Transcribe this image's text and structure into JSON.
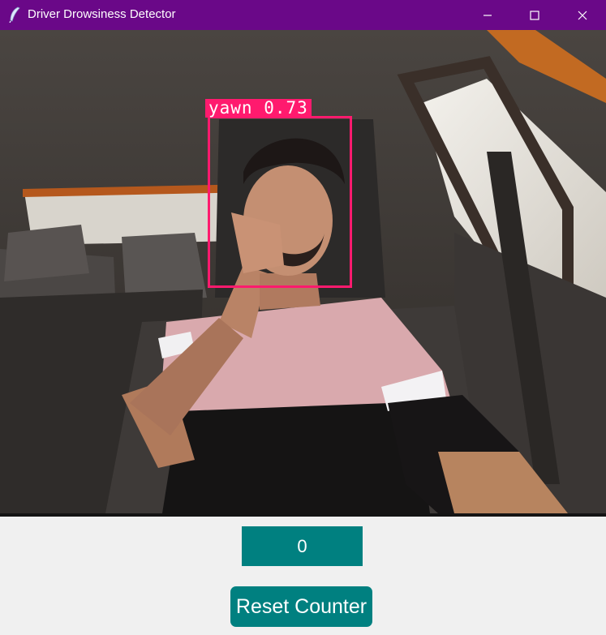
{
  "window": {
    "title": "Driver Drowsiness Detector",
    "icon": "feather-icon",
    "controls": [
      "minimize-icon",
      "maximize-icon",
      "close-icon"
    ]
  },
  "video": {
    "detection": {
      "label": "yawn 0.73",
      "box_color": "#ff1a6e"
    }
  },
  "counter": {
    "value": "0",
    "bg": "#008080"
  },
  "reset_button": {
    "label": "Reset Counter",
    "bg": "#008080"
  },
  "colors": {
    "titlebar": "#6a0888",
    "background": "#f0f0f0"
  }
}
